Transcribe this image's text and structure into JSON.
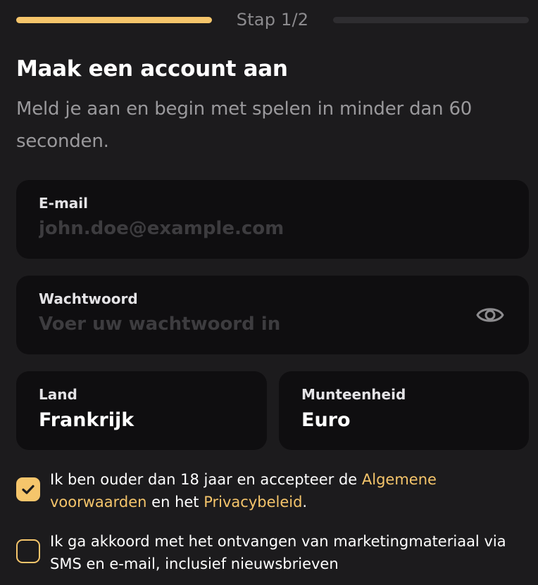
{
  "progress": {
    "step_label": "Stap 1/2",
    "current_step": 1,
    "total_steps": 2
  },
  "header": {
    "title": "Maak een account aan",
    "subtitle": "Meld je aan en begin met spelen in minder dan 60 seconden."
  },
  "form": {
    "email": {
      "label": "E-mail",
      "placeholder": "john.doe@example.com",
      "value": ""
    },
    "password": {
      "label": "Wachtwoord",
      "placeholder": "Voer uw wachtwoord in",
      "value": "",
      "toggle_icon": "eye-icon"
    },
    "country": {
      "label": "Land",
      "value": "Frankrijk"
    },
    "currency": {
      "label": "Munteenheid",
      "value": "Euro"
    }
  },
  "consents": {
    "terms": {
      "checked": true,
      "text_before": "Ik ben ouder dan 18 jaar en accepteer de ",
      "terms_link": "Algemene voorwaarden",
      "text_middle": " en het ",
      "privacy_link": "Privacybeleid",
      "text_after": "."
    },
    "marketing": {
      "checked": false,
      "text": "Ik ga akkoord met het ontvangen van marketingmateriaal via SMS en e-mail, inclusief nieuwsbrieven"
    }
  },
  "colors": {
    "accent": "#f5c56b",
    "background": "#1c1b1d",
    "field_background": "#0f0e10",
    "muted_text": "#9a999c"
  }
}
